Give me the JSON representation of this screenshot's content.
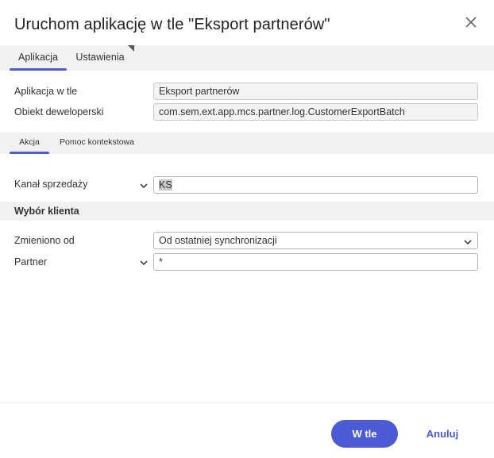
{
  "dialog": {
    "title": "Uruchom aplikację w tle \"Eksport partnerów\""
  },
  "tabs": [
    {
      "label": "Aplikacja",
      "active": true
    },
    {
      "label": "Ustawienia",
      "active": false
    }
  ],
  "info": {
    "app_label": "Aplikacja w tle",
    "app_value": "Eksport partnerów",
    "dev_label": "Obiekt deweloperski",
    "dev_value": "com.sem.ext.app.mcs.partner.log.CustomerExportBatch"
  },
  "subtabs": [
    {
      "label": "Akcja",
      "active": true
    },
    {
      "label": "Pomoc kontekstowa",
      "active": false
    }
  ],
  "form": {
    "channel_label": "Kanał sprzedaży",
    "channel_value": "KS",
    "section_title": "Wybór klienta",
    "changed_label": "Zmieniono od",
    "changed_value": "Od ostatniej synchronizacji",
    "partner_label": "Partner",
    "partner_value": "*"
  },
  "footer": {
    "primary_label": "W tle",
    "cancel_label": "Anuluj"
  },
  "colors": {
    "accent": "#4a5bd4",
    "band": "#f2f2f2"
  },
  "icons": {
    "close": "close-icon",
    "chevron": "chevron-down-icon"
  }
}
